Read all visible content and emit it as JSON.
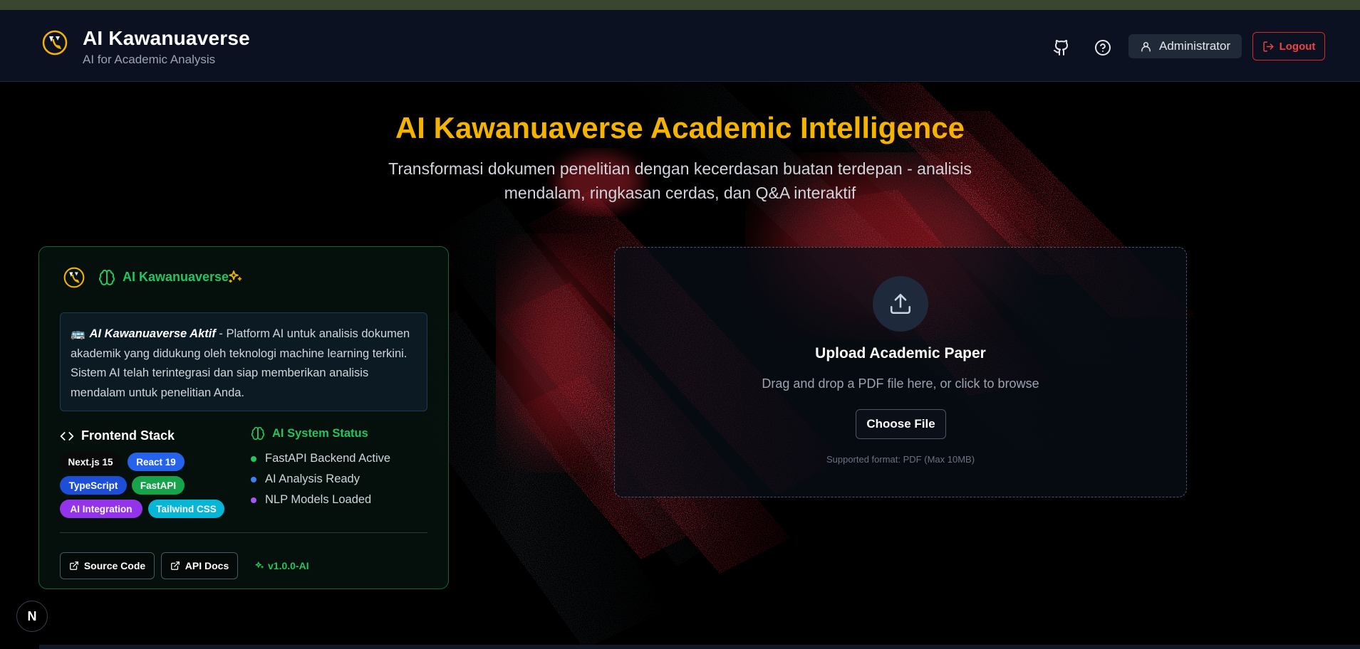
{
  "header": {
    "title": "AI Kawanuaverse",
    "subtitle": "AI for Academic Analysis",
    "user_label": "Administrator",
    "logout_label": "Logout"
  },
  "hero": {
    "title": "AI Kawanuaverse Academic Intelligence",
    "subtitle": "Transformasi dokumen penelitian dengan kecerdasan buatan terdepan - analisis mendalam, ringkasan cerdas, dan Q&A interaktif"
  },
  "info_card": {
    "title": "AI Kawanuaverse",
    "notice_emoji": "🚌",
    "notice_bold": "AI Kawanuaverse Aktif",
    "notice_text": " - Platform AI untuk analisis dokumen akademik yang didukung oleh teknologi machine learning terkini. Sistem AI telah terintegrasi dan siap memberikan analisis mendalam untuk penelitian Anda.",
    "stack_title": "Frontend Stack",
    "tags": [
      {
        "label": "Next.js 15",
        "color": "#0a0a0a"
      },
      {
        "label": "React 19",
        "color": "#2563eb"
      },
      {
        "label": "TypeScript",
        "color": "#1d4ed8"
      },
      {
        "label": "FastAPI",
        "color": "#16a34a"
      },
      {
        "label": "AI Integration",
        "color": "#9333ea"
      },
      {
        "label": "Tailwind CSS",
        "color": "#06b6d4"
      }
    ],
    "status_title": "AI System Status",
    "status_items": [
      {
        "label": "FastAPI Backend Active",
        "color": "#22c55e"
      },
      {
        "label": "AI Analysis Ready",
        "color": "#3b82f6"
      },
      {
        "label": "NLP Models Loaded",
        "color": "#a855f7"
      }
    ],
    "source_code_label": "Source Code",
    "api_docs_label": "API Docs",
    "version_label": "v1.0.0-AI"
  },
  "upload": {
    "title": "Upload Academic Paper",
    "subtitle": "Drag and drop a PDF file here, or click to browse",
    "button_label": "Choose File",
    "note": "Supported format: PDF (Max 10MB)"
  },
  "badge": {
    "letter": "N"
  },
  "colors": {
    "accent_gold": "#f5b301",
    "accent_green": "#22c55e",
    "logout_red": "#ef4444",
    "header_bg": "#0b1120"
  },
  "icons": [
    "github-icon",
    "help-icon",
    "user-icon",
    "logout-icon",
    "brain-icon",
    "sparkles-icon",
    "code-icon",
    "external-link-icon",
    "upload-icon"
  ]
}
